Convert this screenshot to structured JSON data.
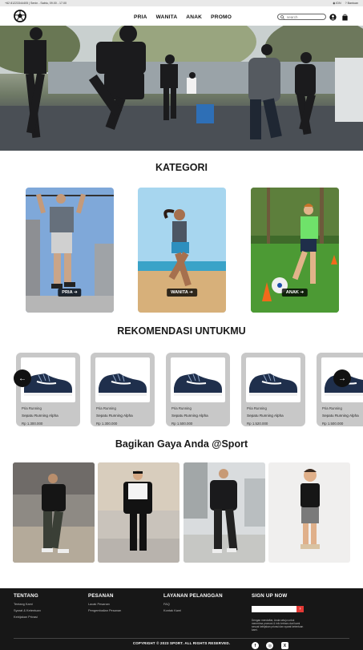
{
  "topbar": {
    "contact": "+62 81223344405 | Senin - Sabtu, 09.00 - 17.00",
    "region": "IDN",
    "help": "Bantuan"
  },
  "nav": {
    "menu": [
      "PRIA",
      "WANITA",
      "ANAK",
      "PROMO"
    ],
    "search_placeholder": "search"
  },
  "kategori": {
    "title": "KATEGORI",
    "items": [
      "PRIA",
      "WANITA",
      "ANAK"
    ]
  },
  "rekomendasi": {
    "title": "REKOMENDASI UNTUKMU",
    "products": [
      {
        "category": "Pria Running",
        "name": "Sepatu Running Alpha",
        "price": "Rp 1.300.000"
      },
      {
        "category": "Pria Running",
        "name": "Sepatu Running Alpha",
        "price": "Rp 1.300.000"
      },
      {
        "category": "Pria Running",
        "name": "Sepatu Running Alpha",
        "price": "Rp 1.500.000"
      },
      {
        "category": "Pria Running",
        "name": "Sepatu Running Alpha",
        "price": "Rp 1.520.000"
      },
      {
        "category": "Pria Running",
        "name": "Sepatu Running Alpha",
        "price": "Rp 1.500.000"
      }
    ]
  },
  "gaya": {
    "title": "Bagikan Gaya Anda @Sport"
  },
  "footer": {
    "tentang": {
      "title": "TENTANG",
      "links": [
        "Tentang Kami",
        "Syarat & Ketentuan",
        "Kebijakan Privasi"
      ]
    },
    "pesanan": {
      "title": "PESANAN",
      "links": [
        "Lacak Pesanan",
        "Pengembalian Pesanan"
      ]
    },
    "layanan": {
      "title": "LAYANAN PELANGGAN",
      "links": [
        "FAQ",
        "Kontak Kami"
      ]
    },
    "signup": {
      "title": "SIGN UP NOW",
      "note": "Dengan mendaftar, Anda setuju untuk menerima promosi & info terbaru dari kami sesuai kebijakan privasi dan syarat ketentuan kami."
    },
    "social": [
      "facebook-icon",
      "instagram-icon",
      "x-icon"
    ],
    "copyright": "COPYRIGHT © 2023 SPORT. ALL RIGHTS RESERVED."
  },
  "colors": {
    "dark": "#171717",
    "accent": "#e53935",
    "card": "#c8c8c8"
  }
}
